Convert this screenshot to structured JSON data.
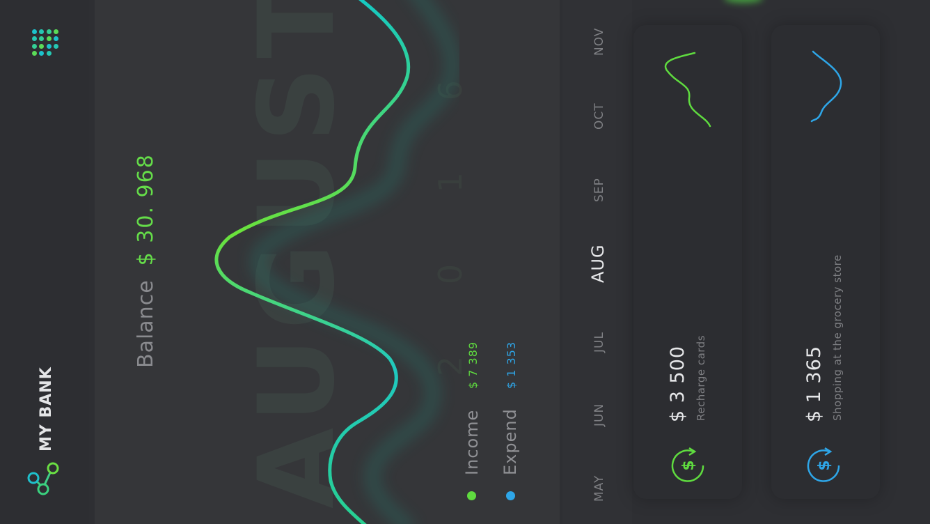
{
  "app": {
    "name": "MY BANK",
    "menu_icon": "apps-grid-icon",
    "logo_icon": "share-nodes-icon"
  },
  "balance": {
    "label": "Balance",
    "value": "$ 30. 968"
  },
  "period": {
    "month": "AUGUST",
    "year": "2 0 1 6"
  },
  "legend": [
    {
      "label": "Income",
      "value": "$ 7 389",
      "color": "#5fdb3f"
    },
    {
      "label": "Expend",
      "value": "$ 1 353",
      "color": "#2ea6e8"
    }
  ],
  "months": [
    {
      "label": "MAY",
      "active": false
    },
    {
      "label": "JUN",
      "active": false
    },
    {
      "label": "JUL",
      "active": false
    },
    {
      "label": "AUG",
      "active": true
    },
    {
      "label": "SEP",
      "active": false
    },
    {
      "label": "OCT",
      "active": false
    },
    {
      "label": "NOV",
      "active": false
    }
  ],
  "transactions": [
    {
      "amount": "$ 3 500",
      "description": "Recharge cards",
      "icon": "dollar-refresh-icon",
      "color": "#5fdb3f"
    },
    {
      "amount": "$ 1 365",
      "description": "Shopping at the grocery store",
      "icon": "dollar-refresh-icon",
      "color": "#2ea6e8"
    }
  ],
  "colors": {
    "income": "#5fdb3f",
    "expend": "#2ea6e8",
    "wave_start": "#6fe23a",
    "wave_end": "#12c6c7"
  }
}
